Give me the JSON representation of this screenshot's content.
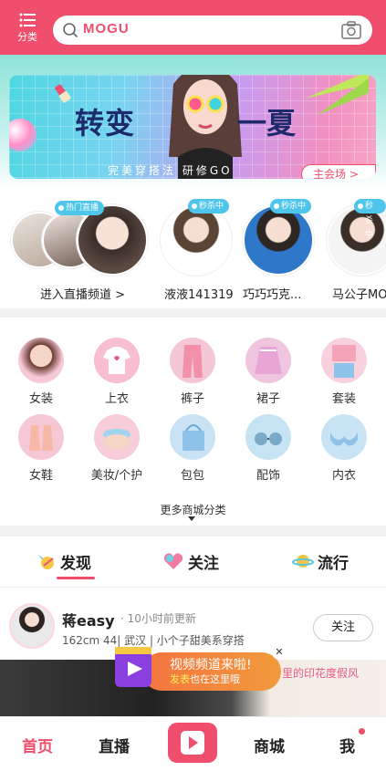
{
  "header": {
    "category_label": "分类",
    "search_logo": "MOGU"
  },
  "banner": {
    "title_left": "转变",
    "title_right": "一夏",
    "subtitle": "完美穿搭法 研修GO",
    "cta": "主会场 >"
  },
  "live": {
    "items": [
      {
        "label": "进入直播频道 >",
        "badge": "热门直播"
      },
      {
        "label": "液液141319",
        "badge": "秒杀中"
      },
      {
        "label": "巧巧巧克...",
        "badge": "秒杀中"
      },
      {
        "label": "马公子MO",
        "badge": "秒杀中"
      }
    ]
  },
  "categories": {
    "items": [
      {
        "name": "女装",
        "color": "#f7c9d7"
      },
      {
        "name": "上衣",
        "color": "#f7bfd0"
      },
      {
        "name": "裤子",
        "color": "#f4c7d6"
      },
      {
        "name": "裙子",
        "color": "#f0c5e0"
      },
      {
        "name": "套装",
        "color": "#f7d1de"
      },
      {
        "name": "女鞋",
        "color": "#f6c8d6"
      },
      {
        "name": "美妆/个护",
        "color": "#f6cdd9"
      },
      {
        "name": "包包",
        "color": "#c9e2f4"
      },
      {
        "name": "配饰",
        "color": "#c5e3f3"
      },
      {
        "name": "内衣",
        "color": "#c8e3f4"
      }
    ],
    "more_label": "更多商城分类"
  },
  "tabs": {
    "items": [
      {
        "label": "发现"
      },
      {
        "label": "关注"
      },
      {
        "label": "流行"
      }
    ]
  },
  "post": {
    "name": "蒋easy",
    "time": "· 10小时前更新",
    "meta": "162cm 44|   武汉   |  小个子甜美系穿搭",
    "follow": "关注",
    "caption": "日里的印花度假风"
  },
  "popup": {
    "title": "视频频道来啦!",
    "line_prefix": "发表",
    "line_rest": "也在这里哦"
  },
  "bottom_nav": {
    "home": "首页",
    "live": "直播",
    "mall": "商城",
    "me": "我"
  },
  "colors": {
    "brand": "#ef4e6c"
  }
}
